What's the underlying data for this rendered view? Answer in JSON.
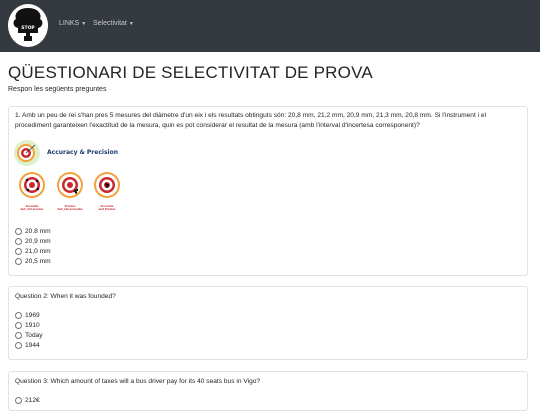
{
  "nav": {
    "logo_alt": "logo",
    "links_label": "LINKS",
    "selectivitat_label": "Selectivitat"
  },
  "page": {
    "title": "QÜESTIONARI DE SELECTIVITAT DE PROVA",
    "subtitle": "Respon les següents preguntes"
  },
  "questions": [
    {
      "text": "1. Amb un peu de rei s'han pres 5 mesures del diàmetre d'un eix i els resultats obtinguts són: 20,8 mm, 21,2 mm, 20,9 mm, 21,3 mm, 20,8 mm. Si l'instrument i el procediment garanteixen l'exactitud de la mesura, quin es pot considerar el resultat de la mesura (amb l'interval d'incertesa corresponent)?",
      "image": {
        "title": "Accuracy & Precision",
        "labels": [
          "Accurate\nbut_not precise",
          "Precise\nbut_not accurate",
          "Accurate\nand Precise"
        ]
      },
      "options": [
        "20.8 mm",
        "20,9 mm",
        "21,0 mm",
        "20,5 mm"
      ]
    },
    {
      "text": "Question 2: When it was founded?",
      "options": [
        "1969",
        "1910",
        "Today",
        "1944"
      ]
    },
    {
      "text": "Question 3: Which amount of taxes will a bus driver pay for its 40 seats bus in Vigo?",
      "options": [
        "212€"
      ]
    }
  ],
  "colors": {
    "navbar": "#343a40",
    "target_red": "#c8282d",
    "target_orange": "#f2a23c",
    "title_blue": "#1a3a6e"
  }
}
